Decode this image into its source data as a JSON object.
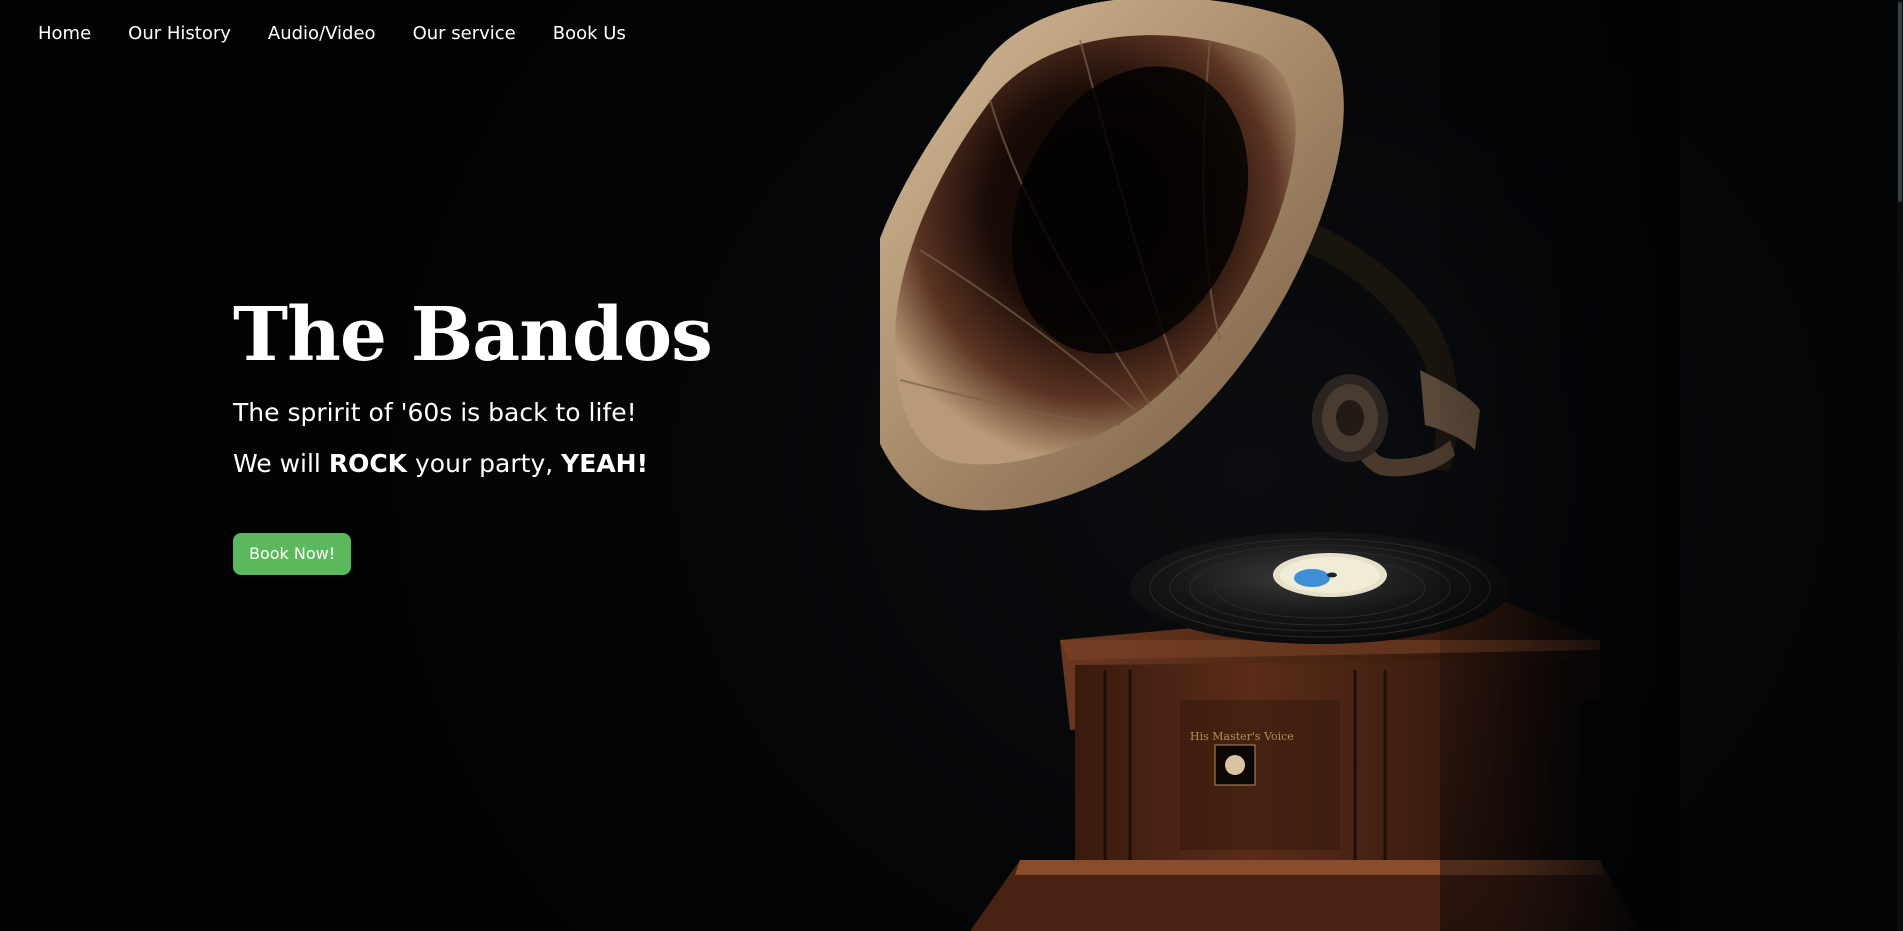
{
  "nav": {
    "items": [
      "Home",
      "Our History",
      "Audio/Video",
      "Our service",
      "Book Us"
    ]
  },
  "hero": {
    "title": "The Bandos",
    "tagline": "The spririt of '60s is back to life!",
    "tagline2_pre": "We will ",
    "tagline2_rock": "ROCK",
    "tagline2_mid": " your party, ",
    "tagline2_yeah": "YEAH!",
    "cta_label": "Book Now!"
  },
  "image": {
    "subject": "vintage gramophone",
    "record_label": "His Master's Voice"
  },
  "colors": {
    "background": "#030507",
    "cta": "#5cb85c",
    "text": "#ffffff"
  }
}
